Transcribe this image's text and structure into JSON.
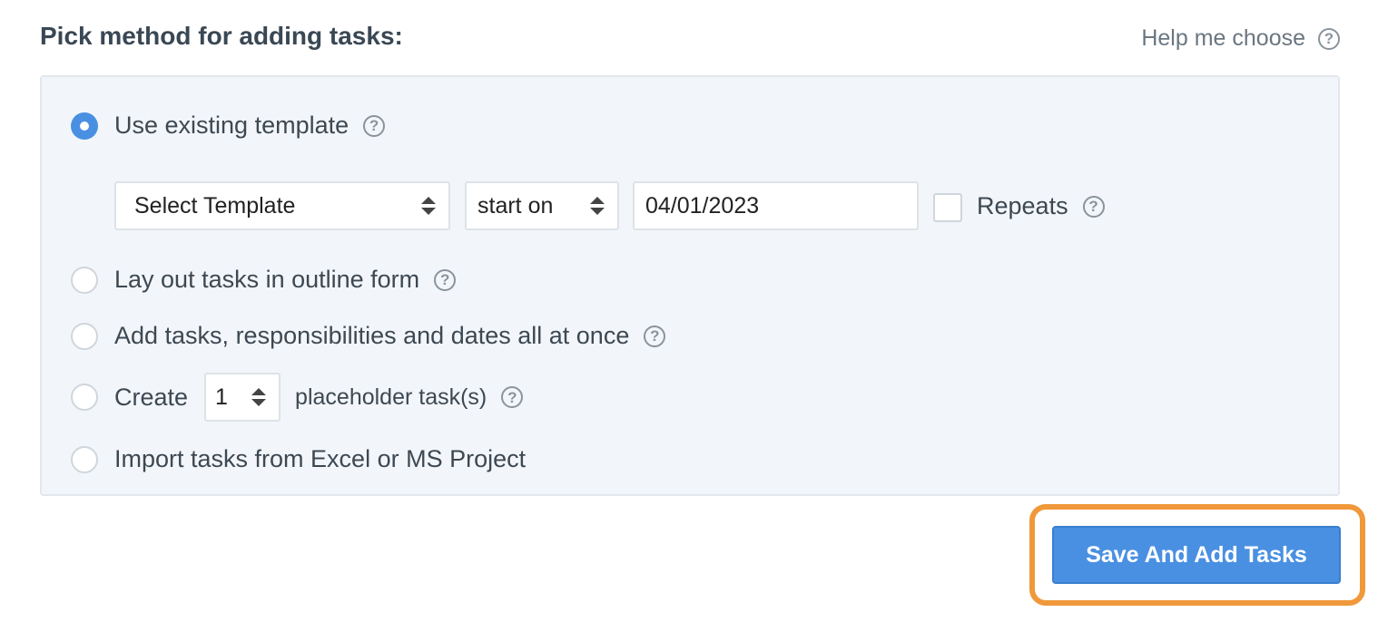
{
  "heading": "Pick method for adding tasks:",
  "help_link": {
    "label": "Help me choose",
    "icon": "question-circle-icon"
  },
  "options": [
    {
      "label": "Use existing template",
      "checked": true,
      "icon": "question-circle-icon"
    },
    {
      "label": "Lay out tasks in outline form",
      "checked": false,
      "icon": "question-circle-icon"
    },
    {
      "label": "Add tasks, responsibilities and dates all at once",
      "checked": false,
      "icon": "question-circle-icon"
    },
    {
      "label_before": "Create",
      "label_after": "placeholder task(s)",
      "count_value": "1",
      "checked": false,
      "icon": "question-circle-icon"
    },
    {
      "label": "Import tasks from Excel or MS Project",
      "checked": false
    }
  ],
  "template_row": {
    "template_select": "Select Template",
    "start_select": "start on",
    "date_value": "04/01/2023",
    "repeats_label": "Repeats",
    "repeats_checked": false
  },
  "save_button": "Save And Add Tasks",
  "colors": {
    "accent": "#4a90e2",
    "highlight": "#f0983a"
  }
}
